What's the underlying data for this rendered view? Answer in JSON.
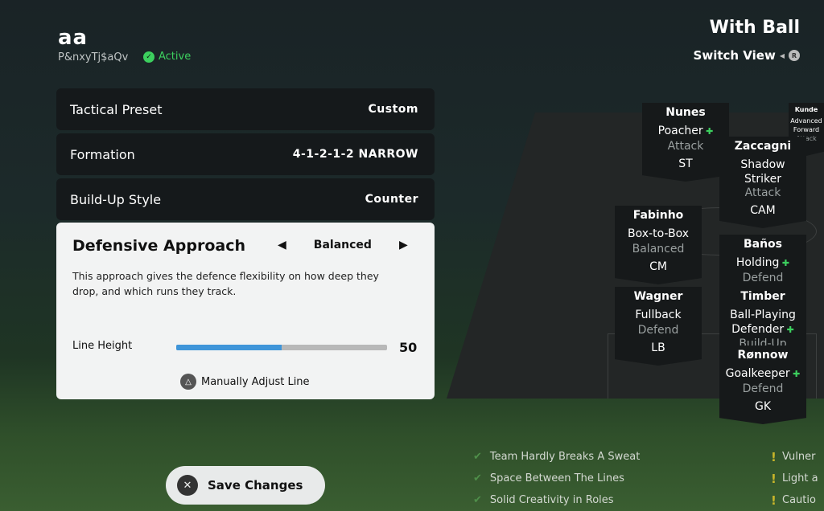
{
  "header": {
    "team_name": "aa",
    "subtitle": "P&nxyTj$aQv",
    "status": "Active"
  },
  "view": {
    "title": "With Ball",
    "switch_label": "Switch View",
    "switch_button": "R"
  },
  "settings": [
    {
      "label": "Tactical Preset",
      "value": "Custom"
    },
    {
      "label": "Formation",
      "value": "4-1-2-1-2 NARROW"
    },
    {
      "label": "Build-Up Style",
      "value": "Counter"
    }
  ],
  "defensive": {
    "title": "Defensive Approach",
    "value": "Balanced",
    "prev": "◀",
    "next": "▶",
    "description": "This approach gives the defence flexibility on how deep they drop, and which runs they track.",
    "line_height_label": "Line Height",
    "line_height_value": "50",
    "line_height_percent": 50,
    "manual_label": "Manually Adjust Line",
    "manual_icon": "△"
  },
  "players": [
    {
      "name": "Nunes",
      "role": "Poacher",
      "focus": "Attack",
      "pos": "ST",
      "plus": true
    },
    {
      "name": "Kunde",
      "role": "Advanced Forward",
      "focus": "Attack",
      "pos": "",
      "plus": false
    },
    {
      "name": "Zaccagni",
      "role": "Shadow Striker",
      "focus": "Attack",
      "pos": "CAM",
      "plus": false
    },
    {
      "name": "Fabinho",
      "role": "Box-to-Box",
      "focus": "Balanced",
      "pos": "CM",
      "plus": false
    },
    {
      "name": "Baños",
      "role": "Holding",
      "focus": "Defend",
      "pos": "",
      "plus": true
    },
    {
      "name": "Wagner",
      "role": "Fullback",
      "focus": "Defend",
      "pos": "LB",
      "plus": false
    },
    {
      "name": "Timber",
      "role": "Ball-Playing Defender",
      "focus": "Build-Up",
      "pos": "",
      "plus": true
    },
    {
      "name": "Rønnow",
      "role": "Goalkeeper",
      "focus": "Defend",
      "pos": "GK",
      "plus": true
    }
  ],
  "strengths": [
    "Team Hardly Breaks A Sweat",
    "Space Between The Lines",
    "Solid Creativity in Roles"
  ],
  "warnings": [
    "Vulner",
    "Light a",
    "Cautio"
  ],
  "save": {
    "label": "Save Changes",
    "icon": "✕"
  },
  "colors": {
    "accent": "#3f95d9",
    "active": "#3ccf5e",
    "warning": "#c8b52a"
  }
}
